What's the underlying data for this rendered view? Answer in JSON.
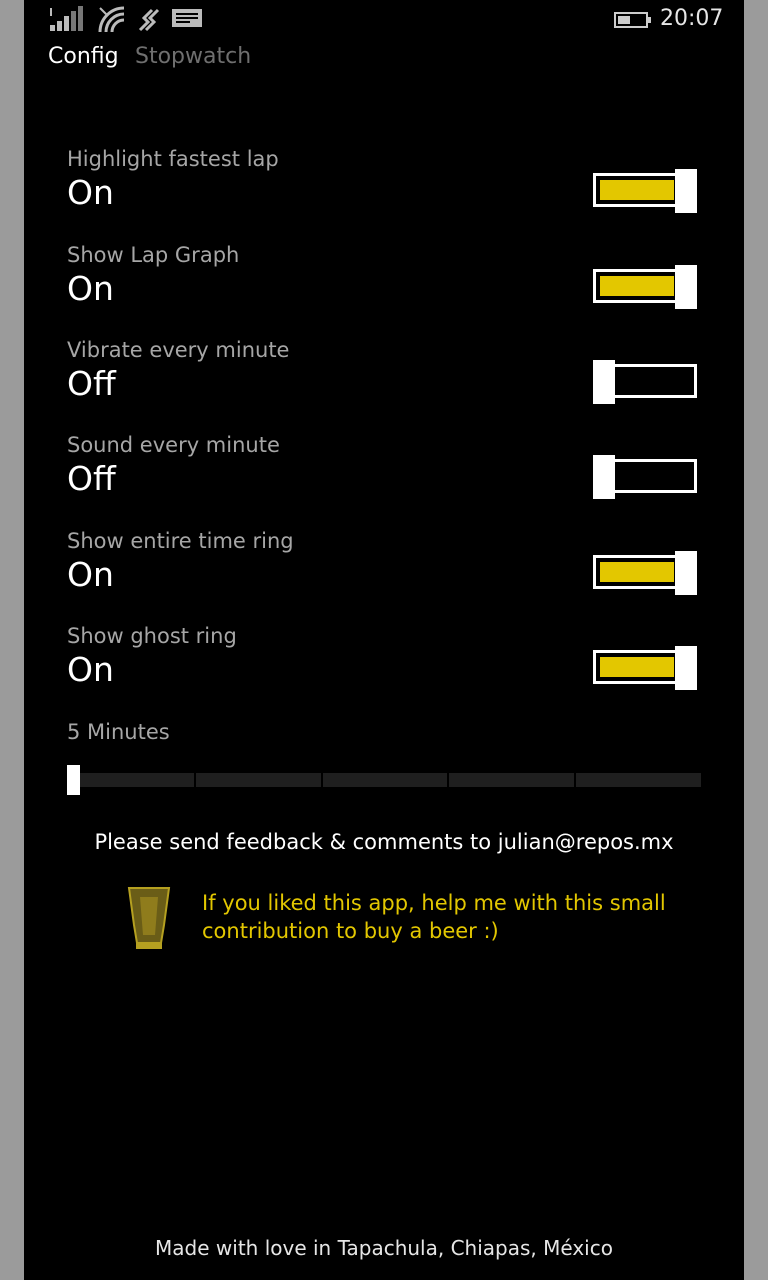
{
  "status_bar": {
    "time": "20:07",
    "icons": [
      "signal-icon",
      "wifi-icon",
      "network-icon",
      "notification-icon",
      "battery-icon"
    ]
  },
  "tabs": [
    {
      "label": "Config",
      "selected": true
    },
    {
      "label": "Stopwatch",
      "selected": false
    }
  ],
  "settings": [
    {
      "label": "Highlight fastest lap",
      "value": "On",
      "state": "on"
    },
    {
      "label": "Show Lap Graph",
      "value": "On",
      "state": "on"
    },
    {
      "label": "Vibrate every minute",
      "value": "Off",
      "state": "off"
    },
    {
      "label": "Sound every minute",
      "value": "Off",
      "state": "off"
    },
    {
      "label": "Show entire time ring",
      "value": "On",
      "state": "on"
    },
    {
      "label": "Show ghost ring",
      "value": "On",
      "state": "on"
    }
  ],
  "slider": {
    "label": "5 Minutes",
    "steps": 5,
    "position": 0
  },
  "feedback": "Please send feedback & comments to julian@repos.mx",
  "beer": {
    "icon": "beer-glass-icon",
    "text": "If you liked this app, help me with this small contribution to buy a beer :)"
  },
  "footer": "Made with love in Tapachula, Chiapas, México",
  "colors": {
    "accent": "#e3c700",
    "background": "#000000",
    "label": "#a6a6a6",
    "inactive_tab": "#6f6f6f"
  }
}
